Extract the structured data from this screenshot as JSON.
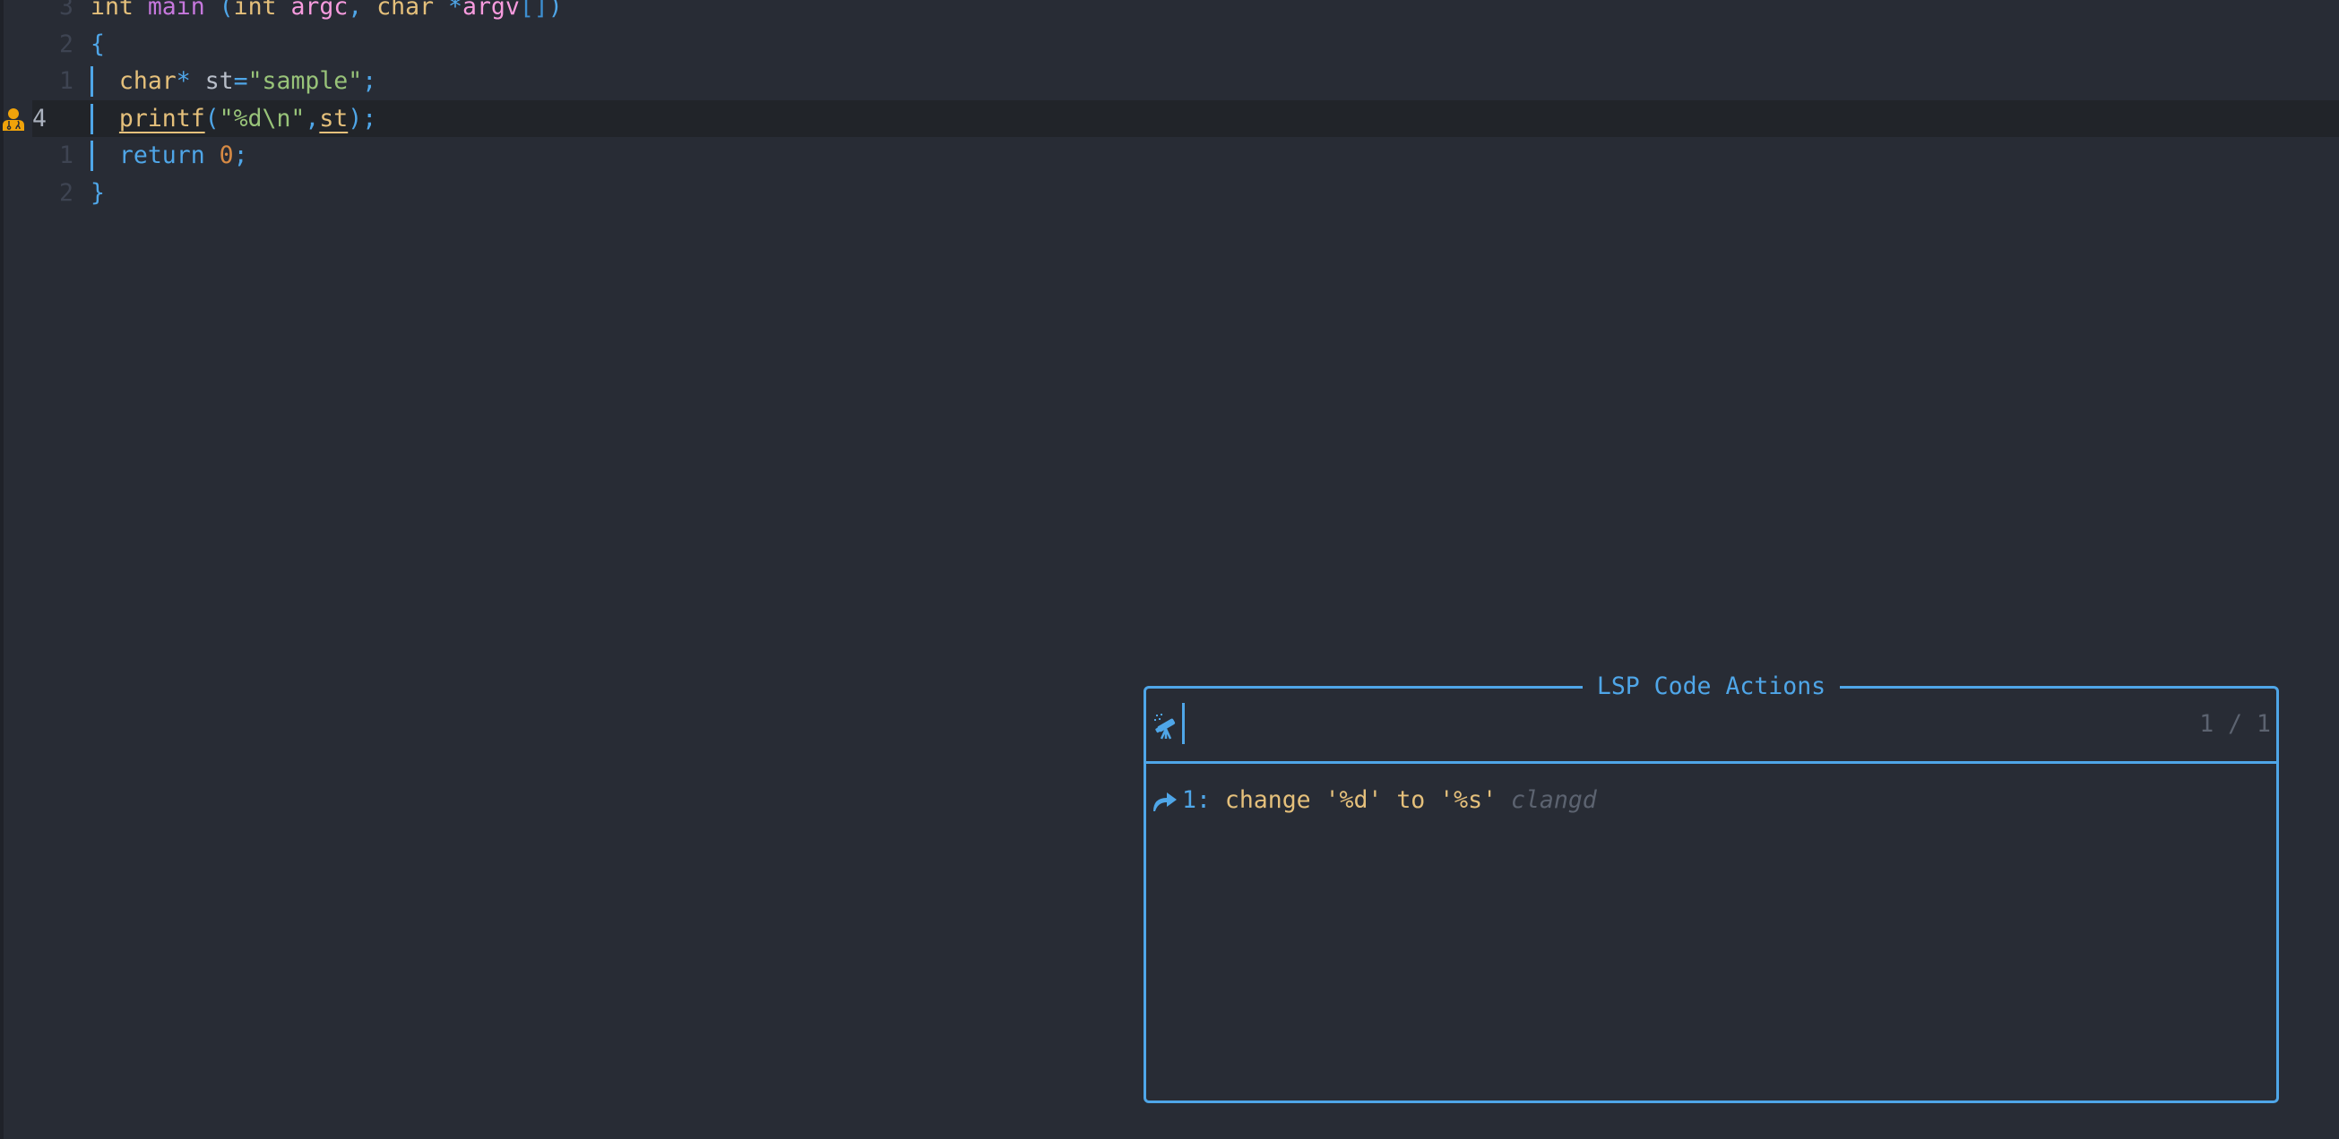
{
  "editor": {
    "lines": [
      {
        "number": "3",
        "tokens": [
          {
            "t": "int",
            "c": "kw-type"
          },
          {
            "t": " ",
            "c": ""
          },
          {
            "t": "main",
            "c": "fn"
          },
          {
            "t": " ",
            "c": ""
          },
          {
            "t": "(",
            "c": "punc"
          },
          {
            "t": "int",
            "c": "kw-type"
          },
          {
            "t": " ",
            "c": ""
          },
          {
            "t": "argc",
            "c": "param"
          },
          {
            "t": ",",
            "c": "punc"
          },
          {
            "t": " ",
            "c": ""
          },
          {
            "t": "char",
            "c": "kw-type"
          },
          {
            "t": " ",
            "c": ""
          },
          {
            "t": "*",
            "c": "punc"
          },
          {
            "t": "argv",
            "c": "param"
          },
          {
            "t": "[]",
            "c": "bracket"
          },
          {
            "t": ")",
            "c": "punc"
          }
        ]
      },
      {
        "number": "2",
        "tokens": [
          {
            "t": "{",
            "c": "punc"
          }
        ]
      },
      {
        "number": "1",
        "guide": true,
        "tokens": [
          {
            "t": "  ",
            "c": ""
          },
          {
            "t": "char",
            "c": "kw-type"
          },
          {
            "t": "*",
            "c": "punc"
          },
          {
            "t": " ",
            "c": ""
          },
          {
            "t": "st",
            "c": "ident"
          },
          {
            "t": "=",
            "c": "punc"
          },
          {
            "t": "\"sample\"",
            "c": "str"
          },
          {
            "t": ";",
            "c": "punc"
          }
        ]
      },
      {
        "number": "4",
        "current": true,
        "sign": "user-doctor-icon",
        "guide": true,
        "tokens": [
          {
            "t": "  ",
            "c": ""
          },
          {
            "t": "printf",
            "c": "call ul"
          },
          {
            "t": "(",
            "c": "punc"
          },
          {
            "t": "\"%d\\n\"",
            "c": "str"
          },
          {
            "t": ",",
            "c": "punc"
          },
          {
            "t": "st",
            "c": "call ul"
          },
          {
            "t": ")",
            "c": "punc"
          },
          {
            "t": ";",
            "c": "punc"
          }
        ]
      },
      {
        "number": "1",
        "guide": true,
        "tokens": [
          {
            "t": "  ",
            "c": ""
          },
          {
            "t": "return",
            "c": "kw"
          },
          {
            "t": " ",
            "c": ""
          },
          {
            "t": "0",
            "c": "num"
          },
          {
            "t": ";",
            "c": "punc"
          }
        ]
      },
      {
        "number": "2",
        "tokens": [
          {
            "t": "}",
            "c": "punc"
          }
        ]
      }
    ]
  },
  "popup": {
    "title": "LSP Code Actions",
    "prompt_icon": "telescope-icon",
    "prompt_value": "",
    "counter": "1 / 1",
    "results": [
      {
        "icon": "arrow-redo-icon",
        "index": "1:",
        "title": "change '%d' to '%s'",
        "source": "clangd"
      }
    ]
  },
  "colors": {
    "background": "#282c35",
    "accent": "#4fa6e8",
    "hint_sign": "#f0a30a"
  }
}
